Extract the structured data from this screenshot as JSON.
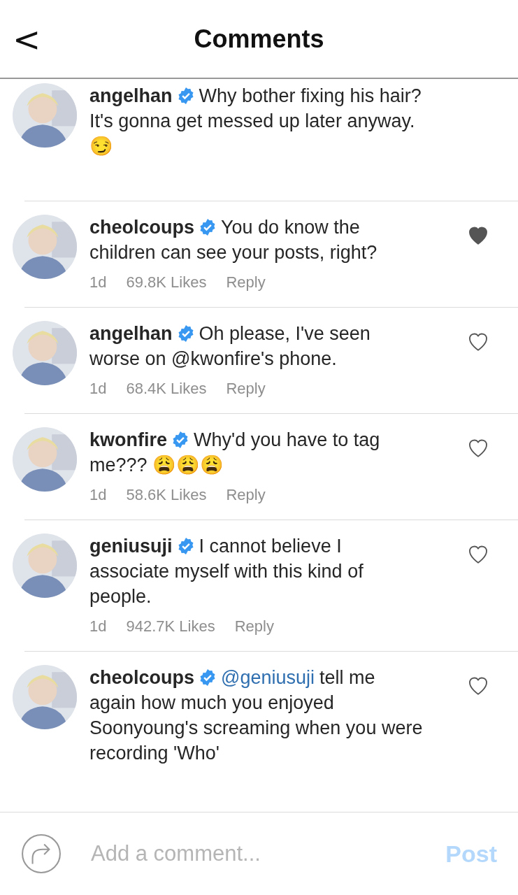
{
  "header": {
    "back": "<",
    "title": "Comments"
  },
  "comments": [
    {
      "user": "angelhan",
      "verified": true,
      "text": "Why bother fixing his hair? It's gonna get messed up later anyway. 😏"
    },
    {
      "user": "cheolcoups",
      "verified": true,
      "text": "You do know the children can see your posts, right?",
      "time": "1d",
      "likes": "69.8K Likes",
      "reply": "Reply",
      "liked": true
    },
    {
      "user": "angelhan",
      "verified": true,
      "text": "Oh please, I've seen worse on @kwonfire's phone.",
      "time": "1d",
      "likes": "68.4K Likes",
      "reply": "Reply",
      "liked": false
    },
    {
      "user": "kwonfire",
      "verified": true,
      "text": "Why'd you have to tag me??? 😩😩😩",
      "time": "1d",
      "likes": "58.6K Likes",
      "reply": "Reply",
      "liked": false
    },
    {
      "user": "geniusuji",
      "verified": true,
      "text": "I cannot believe I associate myself with this kind of people.",
      "time": "1d",
      "likes": "942.7K Likes",
      "reply": "Reply",
      "liked": false
    },
    {
      "user": "cheolcoups",
      "verified": true,
      "mention": "@geniusuji",
      "text": "tell me again how much you enjoyed Soonyoung's screaming when you were recording 'Who'",
      "liked": false
    }
  ],
  "composer": {
    "placeholder": "Add a comment...",
    "post": "Post"
  }
}
